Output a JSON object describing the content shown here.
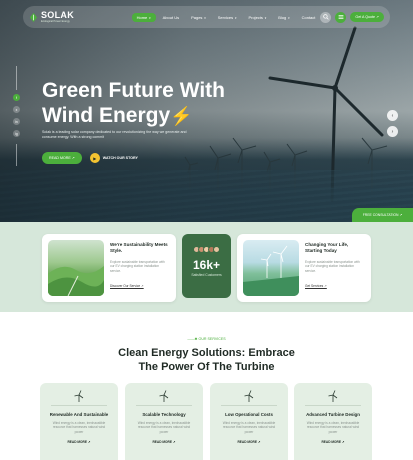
{
  "brand": {
    "name": "SOLAK",
    "tagline": "Ecological Power Energy"
  },
  "nav": {
    "items": [
      {
        "label": "Home",
        "active": true,
        "has_dropdown": true
      },
      {
        "label": "About Us",
        "active": false,
        "has_dropdown": false
      },
      {
        "label": "Pages",
        "active": false,
        "has_dropdown": true
      },
      {
        "label": "Services",
        "active": false,
        "has_dropdown": true
      },
      {
        "label": "Projects",
        "active": false,
        "has_dropdown": true
      },
      {
        "label": "Blog",
        "active": false,
        "has_dropdown": true
      },
      {
        "label": "Contact",
        "active": false,
        "has_dropdown": false
      }
    ],
    "search_icon": "search-icon",
    "menu_icon": "hamburger-icon",
    "cta_label": "Get A Quote ↗"
  },
  "social": [
    "f",
    "x",
    "in",
    "ig"
  ],
  "hero": {
    "title_line1": "Green Future With",
    "title_line2": "Wind Energy",
    "bolt_glyph": "⚡",
    "description": "Solak is a leading solar company dedicated to our revolutionizing the way we generate and consume energy. With a strong commit",
    "read_more_label": "READ MORE ↗",
    "watch_label": "WATCH OUR STORY",
    "prev_icon": "arrow-left-icon",
    "next_icon": "arrow-right-icon",
    "badge_label": "FREE CONSULTATION ↗"
  },
  "info": {
    "card1": {
      "title": "We're Sustainability Meets Style.",
      "text": "Explore sustainable transportation with our EV charging station installation service.",
      "link": "Discover Our Service ↗"
    },
    "stat": {
      "value": "16k+",
      "label": "Satisfied Customers"
    },
    "card2": {
      "title": "Changing Your Life, Starting Today",
      "text": "Explore sustainable transportation with our EV charging station installation service.",
      "link": "Get Services ↗"
    }
  },
  "services": {
    "eyebrow": "——✱ OUR SERVICES",
    "title_line1": "Clean Energy Solutions: Embrace",
    "title_line2": "The Power Of The Turbine",
    "items": [
      {
        "title": "Renewable And Sustainable",
        "text": "Wind energy is a clean, inexhaustible resource that harnesses natural wind power",
        "link": "READ MORE ↗",
        "icon": "wind-turbine-icon"
      },
      {
        "title": "Scalable Technology",
        "text": "Wind energy is a clean, inexhaustible resource that harnesses natural wind power",
        "link": "READ MORE ↗",
        "icon": "wind-turbine-icon"
      },
      {
        "title": "Low Operational Costs",
        "text": "Wind energy is a clean, inexhaustible resource that harnesses natural wind power",
        "link": "READ MORE ↗",
        "icon": "wind-turbine-icon"
      },
      {
        "title": "Advanced Turbine Design",
        "text": "Wind energy is a clean, inexhaustible resource that harnesses natural wind power",
        "link": "READ MORE ↗",
        "icon": "wind-turbine-icon"
      }
    ]
  },
  "colors": {
    "accent": "#4caf3c",
    "dark_green": "#3b6d44",
    "band": "#d6e7da",
    "card": "#e4efe4",
    "bolt": "#f5c431"
  }
}
